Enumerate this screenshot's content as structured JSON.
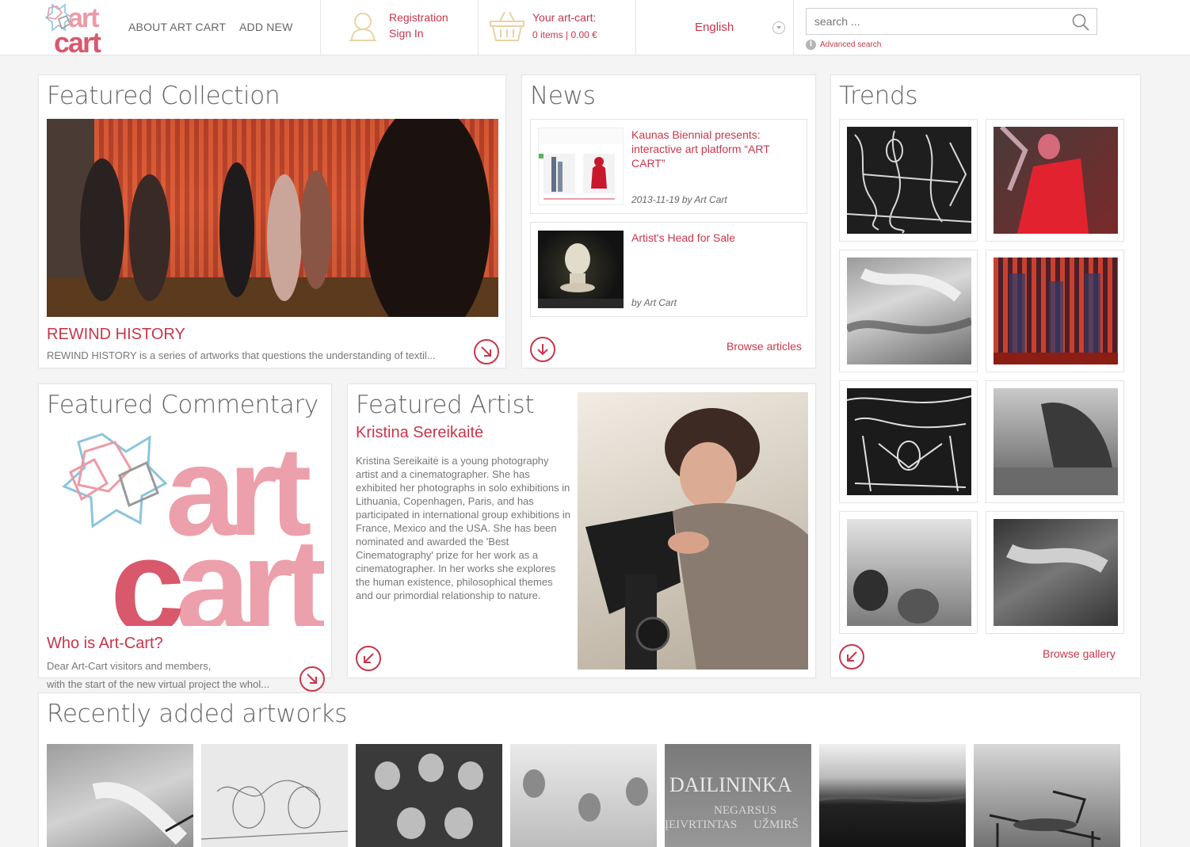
{
  "header": {
    "nav": [
      "ABOUT ART CART",
      "ADD NEW"
    ],
    "account": {
      "register": "Registration",
      "signin": "Sign In"
    },
    "cart": {
      "title": "Your art-cart:",
      "summary": "0 items | 0.00 €"
    },
    "language": "English",
    "search": {
      "placeholder": "search ...",
      "advanced": "Advanced search"
    }
  },
  "logo": {
    "line1": "art",
    "line2": "cart"
  },
  "featured_collection": {
    "heading": "Featured Collection",
    "title": "REWIND HISTORY",
    "description": "REWIND HISTORY is a series of artworks that questions the understanding of textil..."
  },
  "news": {
    "heading": "News",
    "items": [
      {
        "title": "Kaunas Biennial presents: interactive art platform “ART CART”",
        "meta": "2013-11-19 by Art Cart"
      },
      {
        "title": "Artist's Head for Sale",
        "meta": "by Art Cart"
      }
    ],
    "browse": "Browse articles"
  },
  "trends": {
    "heading": "Trends",
    "browse": "Browse gallery"
  },
  "featured_commentary": {
    "heading": "Featured Commentary",
    "title": "Who is Art-Cart?",
    "lines": [
      "Dear Art-Cart visitors and members,",
      "with the start of the new virtual project the whol..."
    ]
  },
  "featured_artist": {
    "heading": "Featured Artist",
    "name": "Kristina Sereikaitė",
    "bio": "Kristina Sereikaitė is a young photography artist and a cinematographer. She has exhibited her photographs in solo exhibitions in Lithuania, Copenhagen, Paris, and has participated in international group exhibitions in France, Mexico and the USA. She has been nominated and awarded the 'Best Cinematography' prize for her work as a cinematographer. In her works she explores the human existence, philosophical themes and our primordial relationship to nature."
  },
  "recent": {
    "heading": "Recently added artworks",
    "thumb4_text": [
      "DAILININKA",
      "NEGARSUS",
      "ĮEIVRTINTAS",
      "UŽMIRŠ"
    ]
  },
  "colors": {
    "accent": "#c8364a",
    "logo_pink": "#ec9aa7",
    "background": "#f4f4f4"
  }
}
